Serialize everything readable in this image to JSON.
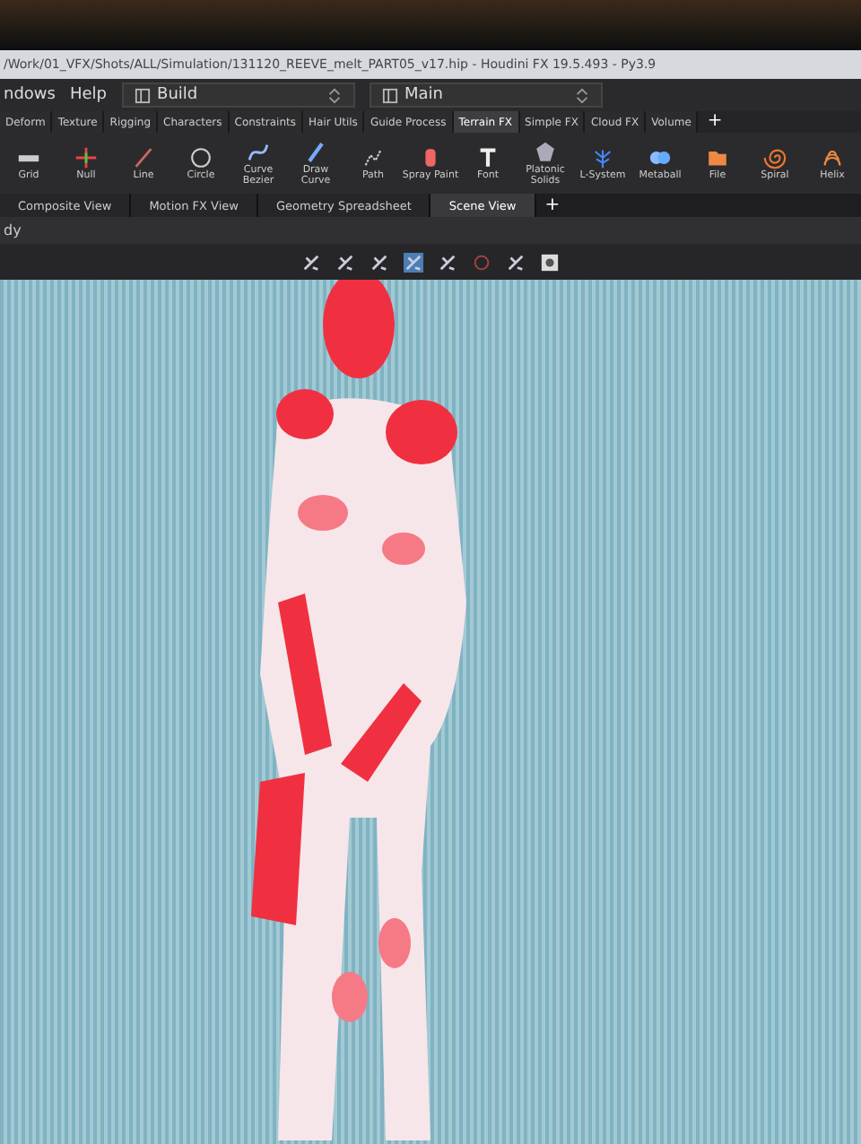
{
  "window": {
    "title": "/Work/01_VFX/Shots/ALL/Simulation/131120_REEVE_melt_PART05_v17.hip - Houdini FX 19.5.493 - Py3.9"
  },
  "menu": [
    "ndows",
    "Help"
  ],
  "desktops": [
    {
      "label": "Build"
    },
    {
      "label": "Main"
    }
  ],
  "shelf_tabs": [
    {
      "label": "Deform",
      "selected": false
    },
    {
      "label": "Texture",
      "selected": false
    },
    {
      "label": "Rigging",
      "selected": false
    },
    {
      "label": "Characters",
      "selected": false
    },
    {
      "label": "Constraints",
      "selected": false
    },
    {
      "label": "Hair Utils",
      "selected": false
    },
    {
      "label": "Guide Process",
      "selected": false
    },
    {
      "label": "Terrain FX",
      "selected": true
    },
    {
      "label": "Simple FX",
      "selected": false
    },
    {
      "label": "Cloud FX",
      "selected": false
    },
    {
      "label": "Volume",
      "selected": false
    }
  ],
  "shelf_add": "+",
  "tools": [
    {
      "label": "Grid",
      "kind": "grid"
    },
    {
      "label": "Null",
      "kind": "null"
    },
    {
      "label": "Line",
      "kind": "line"
    },
    {
      "label": "Circle",
      "kind": "circle"
    },
    {
      "label": "Curve Bezier",
      "kind": "curve"
    },
    {
      "label": "Draw Curve",
      "kind": "pen"
    },
    {
      "label": "Path",
      "kind": "path"
    },
    {
      "label": "Spray Paint",
      "kind": "spray"
    },
    {
      "label": "Font",
      "kind": "font"
    },
    {
      "label": "Platonic Solids",
      "kind": "solid"
    },
    {
      "label": "L-System",
      "kind": "lsystem"
    },
    {
      "label": "Metaball",
      "kind": "metaball"
    },
    {
      "label": "File",
      "kind": "file"
    },
    {
      "label": "Spiral",
      "kind": "spiral"
    },
    {
      "label": "Helix",
      "kind": "helix"
    }
  ],
  "pane_tabs": [
    {
      "label": "Composite View",
      "selected": false
    },
    {
      "label": "Motion FX View",
      "selected": false
    },
    {
      "label": "Geometry Spreadsheet",
      "selected": false
    },
    {
      "label": "Scene View",
      "selected": true
    }
  ],
  "pane_add": "+",
  "path_bar": "dy"
}
